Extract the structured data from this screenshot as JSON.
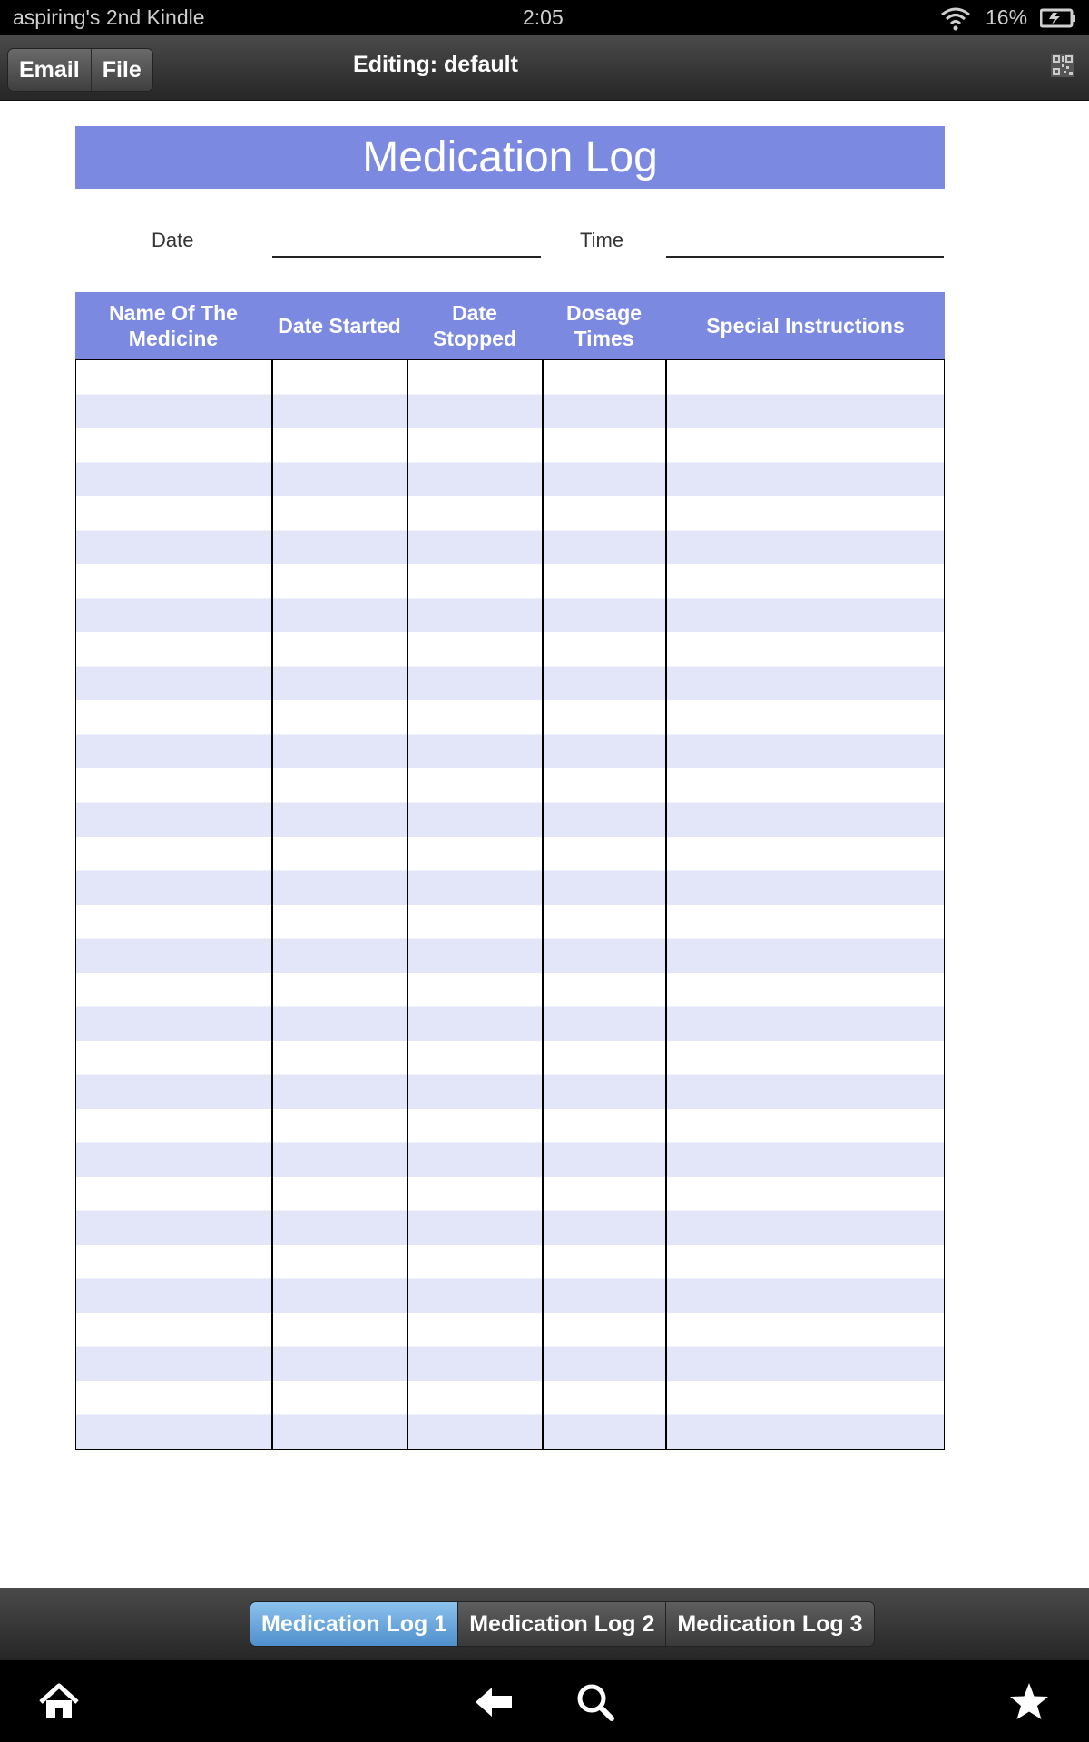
{
  "status_bar": {
    "device_name": "aspiring's 2nd Kindle",
    "time": "2:05",
    "battery": "16%"
  },
  "toolbar": {
    "email_label": "Email",
    "file_label": "File",
    "editing_label": "Editing: default"
  },
  "document": {
    "title": "Medication Log",
    "date_label": "Date",
    "time_label": "Time",
    "columns": [
      "Name Of The\nMedicine",
      "Date Started",
      "Date\nStopped",
      "Dosage\nTimes",
      "Special Instructions"
    ],
    "row_count": 32
  },
  "tabs": [
    "Medication Log 1",
    "Medication Log 2",
    "Medication Log 3"
  ],
  "active_tab": "Medication Log 1",
  "colors": {
    "accent": "#7b8ae0",
    "row_stripe": "#e3e5f8",
    "active_tab": "#5a9ad4"
  }
}
